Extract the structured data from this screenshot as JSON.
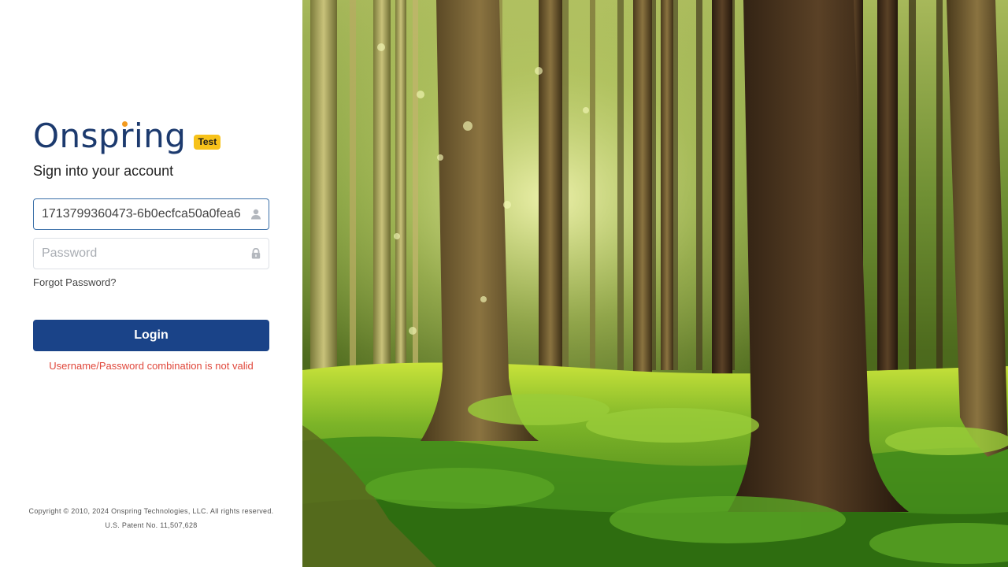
{
  "brand": {
    "name": "Onspring",
    "env_badge": "Test"
  },
  "form": {
    "heading": "Sign into your account",
    "username": {
      "value": "1713799360473-6b0ecfca50a0fea6",
      "icon": "user-icon"
    },
    "password": {
      "placeholder": "Password",
      "value": "",
      "icon": "lock-icon"
    },
    "forgot_label": "Forgot Password?",
    "login_label": "Login",
    "error": "Username/Password combination is not valid"
  },
  "footer": {
    "copyright": "Copyright © 2010, 2024 Onspring Technologies, LLC. All rights reserved.",
    "patent": "U.S. Patent No. 11,507,628"
  },
  "colors": {
    "brand": "#1c3a6e",
    "accent_dot": "#f29a1f",
    "badge": "#f7c21a",
    "button": "#1a4388",
    "error": "#e0473b"
  }
}
